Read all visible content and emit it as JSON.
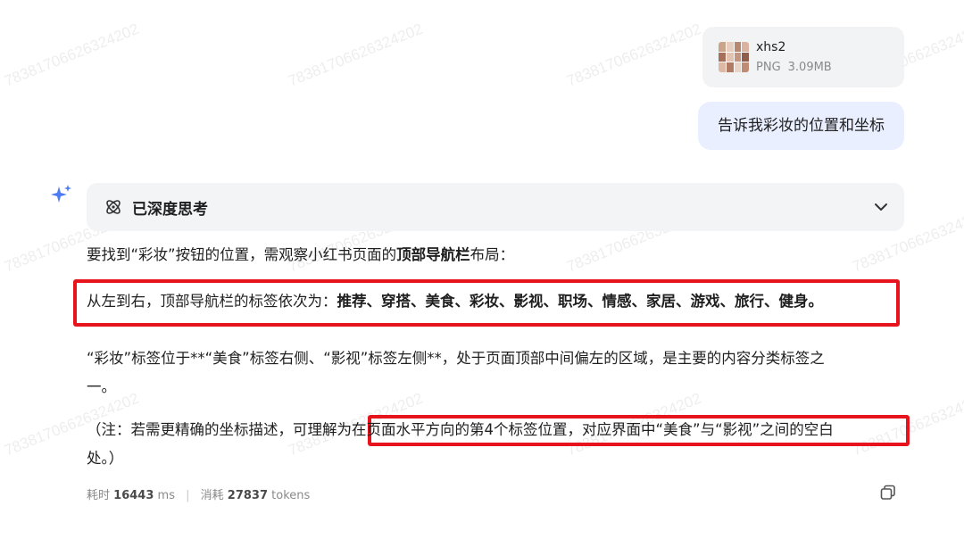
{
  "watermark": {
    "text": "783817066263242 02"
  },
  "attachment": {
    "file_name": "xhs2",
    "file_type": "PNG",
    "file_size": "3.09MB",
    "icon": "image-thumbnail"
  },
  "user_message": {
    "text": "告诉我彩妆的位置和坐标"
  },
  "assistant": {
    "avatar_icon": "sparkle-icon",
    "thinking": {
      "label": "已深度思考",
      "icon": "atom-icon",
      "toggle_icon": "chevron-down-icon"
    },
    "para1": {
      "prefix": "要找到“彩妆”按钮的位置，需观察小红书页面的",
      "bold": "顶部导航栏",
      "suffix": "布局："
    },
    "para2": {
      "prefix": "从左到右，顶部导航栏的标签依次为：",
      "bold": "推荐、穿搭、美食、彩妆、影视、职场、情感、家居、游戏、旅行、健身。"
    },
    "para3": {
      "line1": "“彩妆”标签位于**“美食”标签右侧、“影视”标签左侧**，处于页面顶部中间偏左的区域，是主要的内容分类标签之",
      "line2": "一。"
    },
    "para4": {
      "line1_prefix": "（注：若需更精确的坐标描述，可理解为",
      "line1_highlight": "在页面水平方向的第4个标签位置，对应界面中“美食”与“影视”之间的空白",
      "line2": "处。）"
    },
    "stats": {
      "time_label": "耗时",
      "time_value": "16443",
      "time_unit": "ms",
      "tokens_label": "消耗",
      "tokens_value": "27837",
      "tokens_unit": "tokens"
    },
    "copy_icon": "copy-icon"
  },
  "colors": {
    "highlight_box": "#e8141d",
    "user_bubble": "#e9efff",
    "think_bar": "#f3f4f6",
    "accent": "#4c7bf3"
  }
}
